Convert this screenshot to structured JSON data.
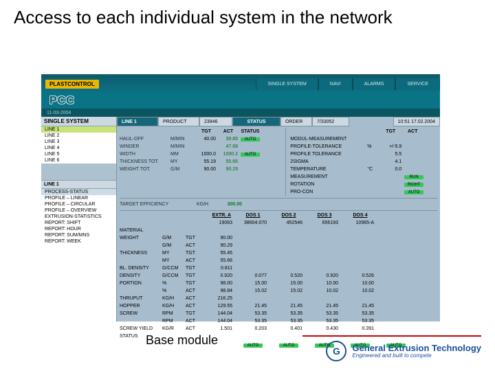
{
  "slide": {
    "title": "Access to each individual system in the network",
    "caption": "Base module"
  },
  "brand": {
    "plast": "PLASTCONTROL",
    "pcc": "PCC",
    "date": "11-03-2004"
  },
  "tabs": [
    "SINGLE SYSTEM",
    "NAVI",
    "ALARMS",
    "SERVICE"
  ],
  "sidebar": {
    "hdr1": "SINGLE SYSTEM",
    "lines": [
      "LINE 1",
      "LINE 2",
      "LINE 3",
      "LINE 4",
      "LINE 5",
      "LINE 6"
    ],
    "hdr2": "LINE 1",
    "menu": [
      "PROCESS-STATUS",
      "PROFILE – LINEAR",
      "PROFILE – CIRCULAR",
      "PROFILE – OVERVIEW",
      "EXTRUSION-STATISTICS",
      "REPORT: SHIFT",
      "REPORT: HOUR",
      "REPORT: SUM/MNS",
      "REPORT: WEEK"
    ]
  },
  "status": {
    "line": "LINE 1",
    "product": "PRODUCT",
    "productv": "23946",
    "status": "STATUS",
    "order": "ORDER",
    "orderv": "7/33052",
    "clock": "10:51  17.02.2004"
  },
  "top_hdr": {
    "c1": "TGT",
    "c2": "ACT",
    "c3": "STATUS"
  },
  "top_rows": [
    {
      "l": "HAUL-OFF",
      "u": "M/MIN",
      "t": "40.00",
      "a": "39.85",
      "s": "AUTO"
    },
    {
      "l": "WINDER",
      "u": "M/MIN",
      "t": "",
      "a": "47.68",
      "s": ""
    },
    {
      "l": "WIDTH",
      "u": "MM",
      "t": "1000.0",
      "a": "1000.2",
      "s": "AUTO"
    },
    {
      "l": "THICKNESS TOT.",
      "u": "MY",
      "t": "55.19",
      "a": "55.66",
      "s": ""
    },
    {
      "l": "WEIGHT TOT.",
      "u": "G/M",
      "t": "90.00",
      "a": "90.29",
      "s": ""
    }
  ],
  "right_rows": [
    {
      "n": "MODUL-MEASUREMENT",
      "u": "",
      "v": "",
      "st": ""
    },
    {
      "n": "PROFILE-TOLERANCE",
      "u": "%",
      "v": "+/-5.9",
      "st": ""
    },
    {
      "n": "PROFILE TOLERANCE",
      "u": "",
      "v": "5.5",
      "st": ""
    },
    {
      "n": "2SIGMA",
      "u": "",
      "v": "4.1",
      "st": ""
    },
    {
      "n": "TEMPERATURE",
      "u": "°C",
      "v": "0.0",
      "st": ""
    },
    {
      "n": "MEASUREMENT",
      "u": "",
      "v": "",
      "st": "RUN"
    },
    {
      "n": "ROTATION",
      "u": "",
      "v": "",
      "st": "RIGHT"
    },
    {
      "n": "PRO-CON",
      "u": "",
      "v": "",
      "st": "AUTO"
    }
  ],
  "eff": {
    "label": "TARGET EFFICIENCY",
    "unit": "KG/H",
    "v": "300.00"
  },
  "dos": {
    "hdr": {
      "extr": "EXTR. A",
      "d": [
        "DOS 1",
        "DOS 2",
        "DOS 3",
        "DOS 4"
      ]
    },
    "codes": [
      "19063",
      "38604.070",
      "452546",
      "656193",
      "10965-A"
    ],
    "rows": [
      {
        "l": "MATERIAL",
        "u": "",
        "t": "",
        "ev": "",
        "d": [
          "",
          "",
          "",
          ""
        ]
      },
      {
        "l": "WEIGHT",
        "u": "G/M",
        "t": "TGT",
        "ev": "90.00",
        "d": [
          "",
          "",
          "",
          ""
        ]
      },
      {
        "l": "",
        "u": "G/M",
        "t": "ACT",
        "ev": "90.29",
        "d": [
          "",
          "",
          "",
          ""
        ]
      },
      {
        "l": "THICKNESS",
        "u": "MY",
        "t": "TGT",
        "ev": "55.45",
        "d": [
          "",
          "",
          "",
          ""
        ]
      },
      {
        "l": "",
        "u": "MY",
        "t": "ACT",
        "ev": "55.66",
        "d": [
          "",
          "",
          "",
          ""
        ]
      },
      {
        "l": "BL. DENSITY",
        "u": "G/CCM",
        "t": "TGT",
        "ev": "0.811",
        "d": [
          "",
          "",
          "",
          ""
        ]
      },
      {
        "l": "DENSITY",
        "u": "G/CCM",
        "t": "TGT",
        "ev": "0.920",
        "d": [
          "0.077",
          "0.520",
          "0.920",
          "0.526"
        ]
      },
      {
        "l": "PORTION",
        "u": "%",
        "t": "TGT",
        "ev": "98.00",
        "d": [
          "15.00",
          "15.00",
          "10.00",
          "10.00"
        ]
      },
      {
        "l": "",
        "u": "%",
        "t": "ACT",
        "ev": "98.84",
        "d": [
          "15.02",
          "15.02",
          "10.02",
          "10.02"
        ]
      },
      {
        "l": "THRUPUT",
        "u": "KG/H",
        "t": "ACT",
        "ev": "216.25",
        "d": [
          "",
          "",
          "",
          ""
        ]
      },
      {
        "l": "HOPPER",
        "u": "KG/H",
        "t": "ACT",
        "ev": "129.55",
        "d": [
          "21.45",
          "21.45",
          "21.45",
          "21.45"
        ]
      },
      {
        "l": "SCREW",
        "u": "RPM",
        "t": "TGT",
        "ev": "144.04",
        "d": [
          "53.35",
          "53.35",
          "53.35",
          "53.35"
        ]
      },
      {
        "l": "",
        "u": "RPM",
        "t": "ACT",
        "ev": "144.04",
        "d": [
          "53.35",
          "53.35",
          "53.35",
          "53.35"
        ]
      },
      {
        "l": "SCREW YIELD",
        "u": "KG/R",
        "t": "ACT",
        "ev": "1.501",
        "d": [
          "0.203",
          "0.401",
          "0.430",
          "0.391"
        ]
      },
      {
        "l": "STATUS",
        "u": "",
        "t": "",
        "ev": "",
        "d": [
          "",
          "",
          "",
          ""
        ]
      }
    ],
    "btns": [
      "AUTO",
      "AUTO",
      "AUTO",
      "AUTO",
      "AUTO"
    ]
  },
  "logo": {
    "name": "General Extrusion Technology",
    "tag": "Engineered and built to compete"
  }
}
